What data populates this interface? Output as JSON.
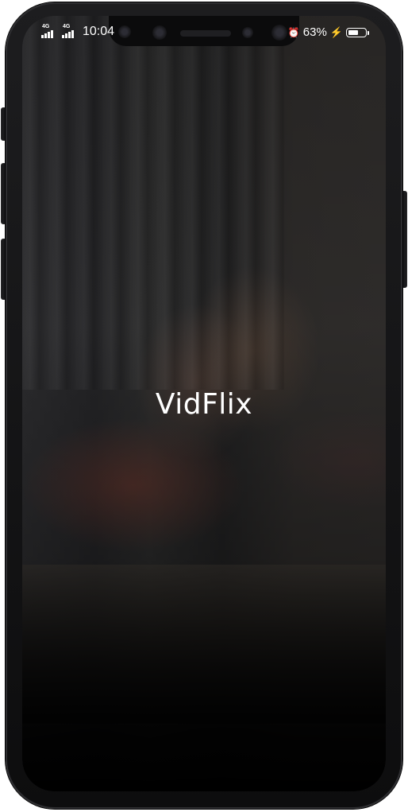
{
  "app": {
    "name": "VidFlix"
  },
  "status_bar": {
    "network_1": "4G",
    "network_2": "4G",
    "time": "10:04",
    "battery_percent": "63%",
    "battery_level": 0.63,
    "charging": true
  },
  "icons": {
    "signal": "signal-bars-icon",
    "alarm": "alarm-icon",
    "bolt": "charging-bolt-icon",
    "battery": "battery-icon"
  },
  "colors": {
    "brand_text": "#ffffff",
    "phone_frame": "#111113"
  }
}
